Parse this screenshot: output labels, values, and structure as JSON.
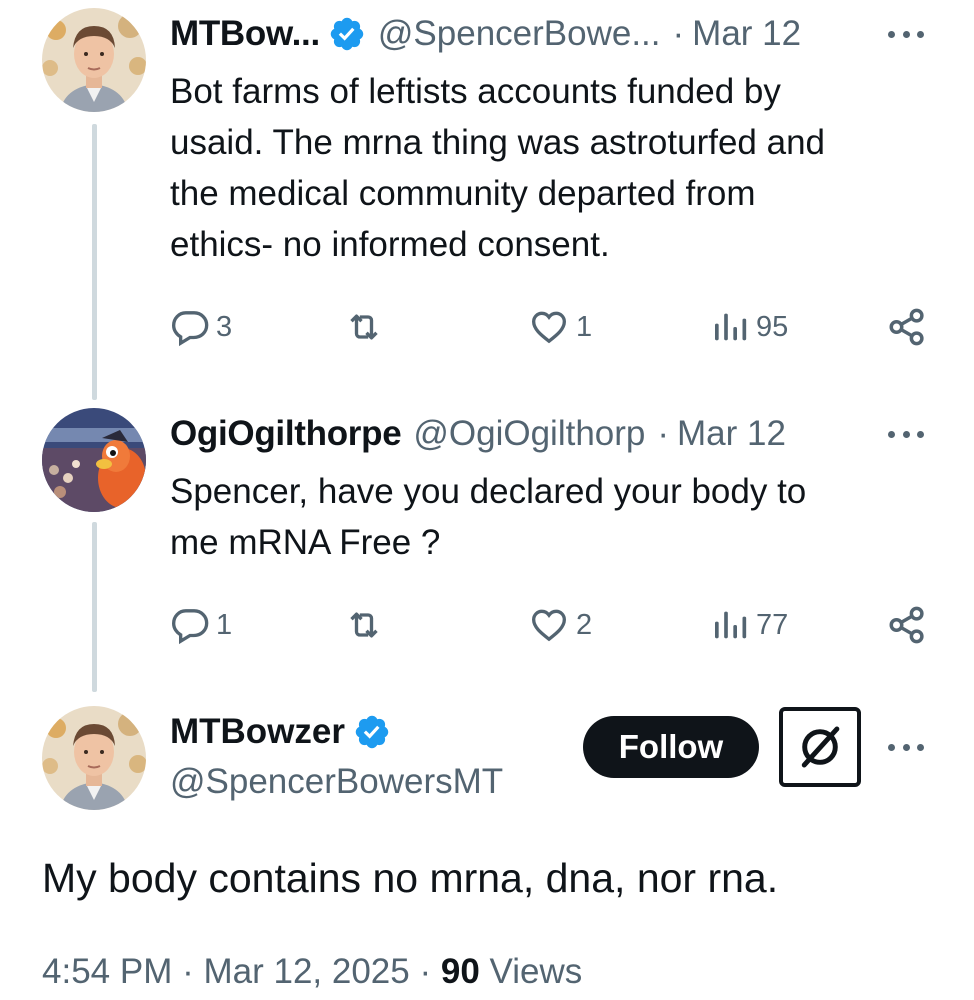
{
  "colors": {
    "text_primary": "#0f1419",
    "text_secondary": "#536471",
    "verified_blue": "#1d9bf0",
    "thread_line": "#cfd9de",
    "follow_bg": "#0f1419"
  },
  "tweets": [
    {
      "display_name": "MTBow...",
      "handle": "@SpencerBowe...",
      "time": "Mar 12",
      "verified": true,
      "text_lines": [
        "Bot farms of leftists accounts funded by",
        "usaid.  The mrna thing was astroturfed and",
        "the medical community departed from",
        "ethics- no informed consent."
      ],
      "replies": "3",
      "reposts": "",
      "likes": "1",
      "views": "95",
      "icons": [
        "reply-icon",
        "repost-icon",
        "like-icon",
        "views-icon",
        "share-icon",
        "more-icon"
      ]
    },
    {
      "display_name": "OgiOgilthorpe",
      "handle": "@OgiOgilthorp",
      "time": "Mar 12",
      "verified": false,
      "text_lines": [
        "Spencer, have you declared your body to",
        "me mRNA Free ?"
      ],
      "replies": "1",
      "reposts": "",
      "likes": "2",
      "views": "77",
      "icons": [
        "reply-icon",
        "repost-icon",
        "like-icon",
        "views-icon",
        "share-icon",
        "more-icon"
      ]
    }
  ],
  "main_tweet": {
    "display_name": "MTBowzer",
    "handle": "@SpencerBowersMT",
    "verified": true,
    "follow_label": "Follow",
    "text": "My body contains no mrna, dna, nor rna.",
    "time": "4:54 PM",
    "date": "Mar 12, 2025",
    "views_count": "90",
    "views_label": "Views",
    "separator": "·",
    "icons": [
      "grok-icon",
      "more-icon"
    ]
  }
}
